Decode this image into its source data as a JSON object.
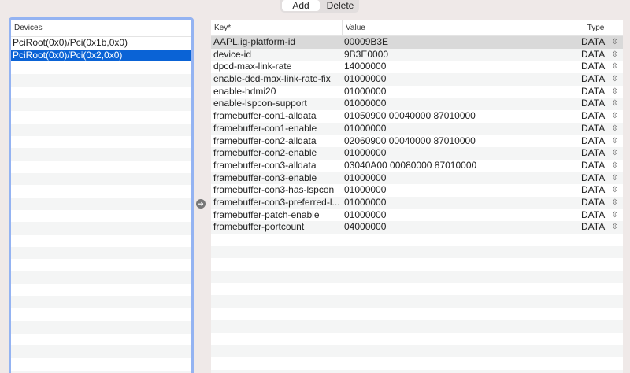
{
  "toolbar": {
    "add_label": "Add",
    "delete_label": "Delete"
  },
  "devices": {
    "header": "Devices",
    "items": [
      "PciRoot(0x0)/Pci(0x1b,0x0)",
      "PciRoot(0x0)/Pci(0x2,0x0)"
    ],
    "selected_index": 1
  },
  "properties": {
    "columns": [
      "Key*",
      "Value",
      "Type"
    ],
    "selected_index": 0,
    "rows": [
      {
        "key": "AAPL,ig-platform-id",
        "value": "00009B3E",
        "type": "DATA"
      },
      {
        "key": "device-id",
        "value": "9B3E0000",
        "type": "DATA"
      },
      {
        "key": "dpcd-max-link-rate",
        "value": "14000000",
        "type": "DATA"
      },
      {
        "key": "enable-dcd-max-link-rate-fix",
        "value": "01000000",
        "type": "DATA"
      },
      {
        "key": "enable-hdmi20",
        "value": "01000000",
        "type": "DATA"
      },
      {
        "key": "enable-lspcon-support",
        "value": "01000000",
        "type": "DATA"
      },
      {
        "key": "framebuffer-con1-alldata",
        "value": "01050900 00040000 87010000",
        "type": "DATA"
      },
      {
        "key": "framebuffer-con1-enable",
        "value": "01000000",
        "type": "DATA"
      },
      {
        "key": "framebuffer-con2-alldata",
        "value": "02060900 00040000 87010000",
        "type": "DATA"
      },
      {
        "key": "framebuffer-con2-enable",
        "value": "01000000",
        "type": "DATA"
      },
      {
        "key": "framebuffer-con3-alldata",
        "value": "03040A00 00080000 87010000",
        "type": "DATA"
      },
      {
        "key": "framebuffer-con3-enable",
        "value": "01000000",
        "type": "DATA"
      },
      {
        "key": "framebuffer-con3-has-lspcon",
        "value": "01000000",
        "type": "DATA"
      },
      {
        "key": "framebuffer-con3-preferred-l...",
        "value": "01000000",
        "type": "DATA"
      },
      {
        "key": "framebuffer-patch-enable",
        "value": "01000000",
        "type": "DATA"
      },
      {
        "key": "framebuffer-portcount",
        "value": "04000000",
        "type": "DATA"
      }
    ]
  }
}
